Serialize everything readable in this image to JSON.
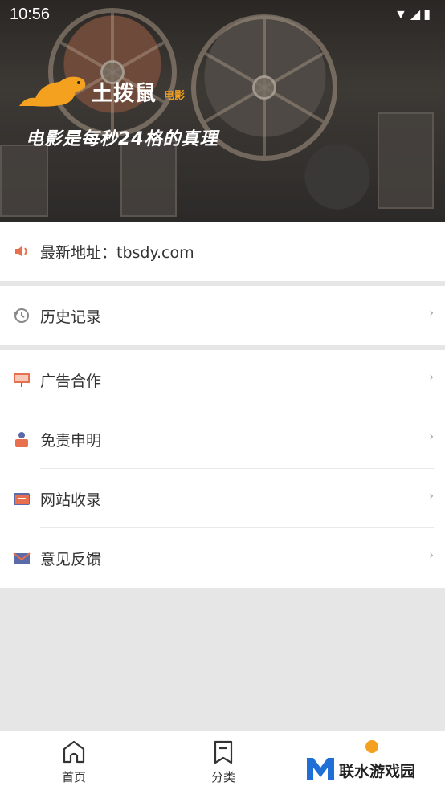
{
  "status_bar": {
    "time": "10:56"
  },
  "banner": {
    "brand_name": "土拨鼠",
    "brand_sub": "电影",
    "slogan": "电影是每秒24格的真理"
  },
  "menu": {
    "address": {
      "prefix": "最新地址：",
      "link": "tbsdy.com",
      "icon": "speaker-icon"
    },
    "history": {
      "label": "历史记录",
      "icon": "history-icon"
    },
    "items": [
      {
        "label": "广告合作",
        "icon": "billboard-icon"
      },
      {
        "label": "免责申明",
        "icon": "person-icon"
      },
      {
        "label": "网站收录",
        "icon": "card-icon"
      },
      {
        "label": "意见反馈",
        "icon": "envelope-icon"
      }
    ],
    "chevron": "›"
  },
  "bottom_nav": {
    "items": [
      {
        "label": "首页",
        "icon": "home-icon"
      },
      {
        "label": "分类",
        "icon": "bookmark-icon"
      }
    ]
  },
  "watermark": {
    "text": "联水游戏园"
  },
  "colors": {
    "accent": "#f3a11f",
    "background": "#e6e6e6"
  }
}
